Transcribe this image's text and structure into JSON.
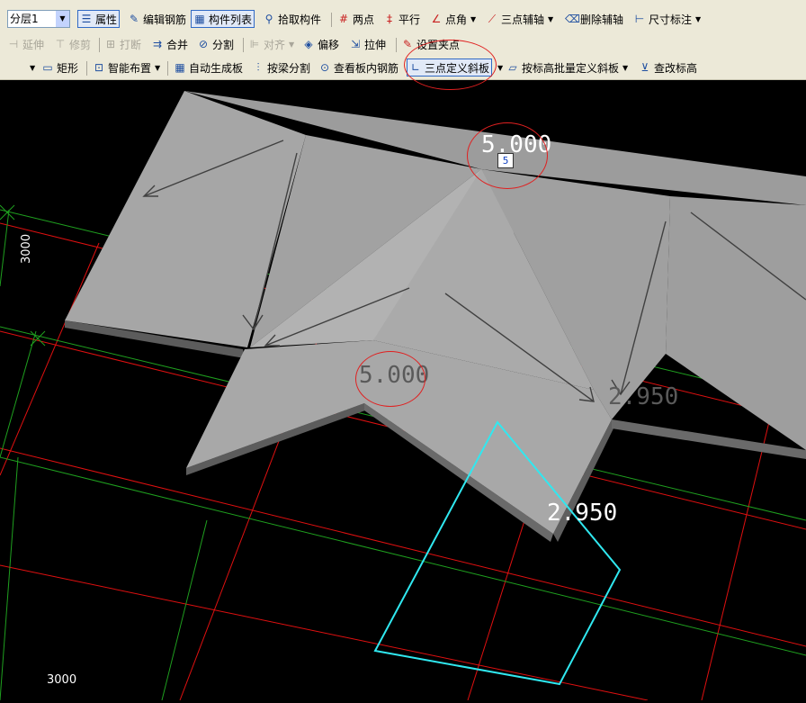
{
  "toolbar1": {
    "layer_select": "分层1",
    "properties": "属性",
    "edit_rebar": "编辑钢筋",
    "component_list": "构件列表",
    "pick_component": "拾取构件",
    "two_points": "两点",
    "parallel": "平行",
    "point_angle": "点角",
    "three_point_axis": "三点辅轴",
    "delete_axis": "删除辅轴",
    "dimension": "尺寸标注"
  },
  "toolbar2": {
    "extend": "延伸",
    "trim": "修剪",
    "break": "打断",
    "merge": "合并",
    "split": "分割",
    "align": "对齐",
    "offset": "偏移",
    "stretch": "拉伸",
    "set_grip": "设置夹点"
  },
  "toolbar3": {
    "rectangle": "矩形",
    "smart_layout": "智能布置",
    "auto_generate": "自动生成板",
    "split_by_beam": "按梁分割",
    "view_rebar": "查看板内钢筋",
    "three_point_slope": "三点定义斜板",
    "batch_slope": "按标高批量定义斜板",
    "edit_elevation": "查改标高"
  },
  "scene": {
    "elev_top": "5.000",
    "input_value": "5",
    "elev_mid": "5.000",
    "elev_right": "2.950",
    "elev_bottom": "2.950",
    "dim_vertical": "3000",
    "dim_horizontal": "3000"
  },
  "colors": {
    "toolbar_bg": "#ece9d8",
    "canvas_bg": "#000000",
    "grid_red": "#e01010",
    "grid_green": "#1fa01f",
    "selection_cyan": "#30e8f0",
    "annotation_red": "#e02020"
  }
}
